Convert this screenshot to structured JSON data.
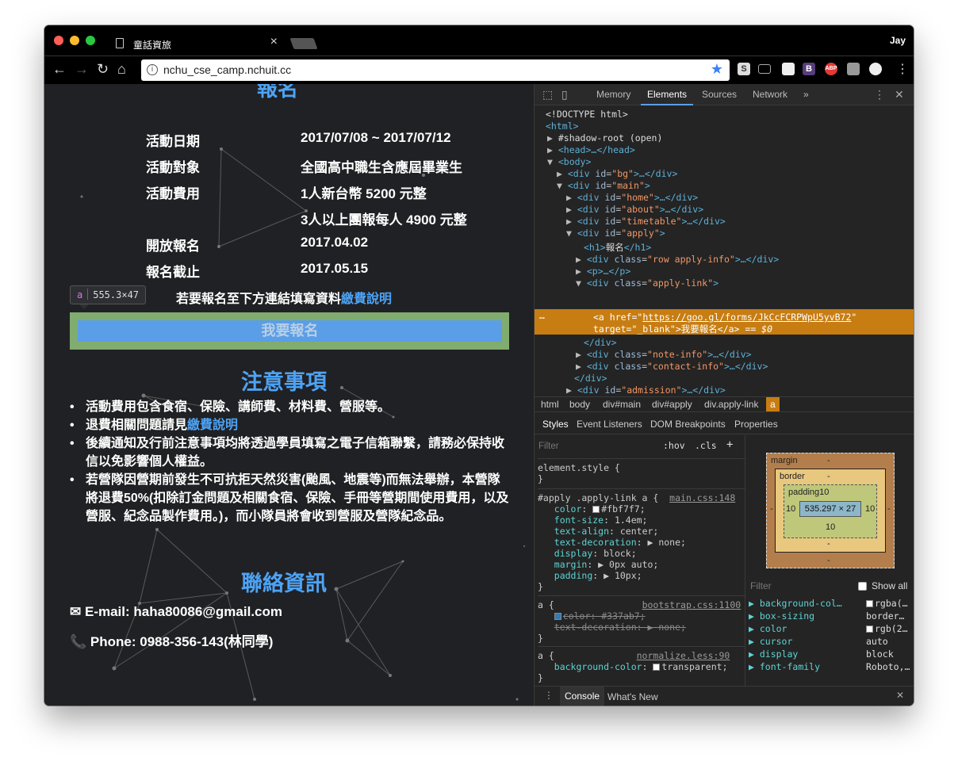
{
  "browser": {
    "tab_title": "童話資旅",
    "tab_close": "×",
    "profile": "Jay",
    "url": "nchu_cse_camp.nchuit.cc",
    "nav": {
      "back": "←",
      "forward": "→",
      "reload": "↻",
      "home": "⌂"
    },
    "star": "★",
    "extensions": [
      "S",
      "B",
      "ABP"
    ]
  },
  "page": {
    "heading_cut": "報名",
    "info_rows": [
      {
        "label": "活動日期",
        "value": "2017/07/08 ~ 2017/07/12"
      },
      {
        "label": "活動對象",
        "value": "全國高中職生含應屆畢業生"
      },
      {
        "label": "活動費用",
        "value": "1人新台幣 5200 元整"
      },
      {
        "label": "",
        "value": "3人以上團報每人 4900 元整"
      },
      {
        "label": "開放報名",
        "value": "2017.04.02"
      },
      {
        "label": "報名截止",
        "value": "2017.05.15"
      }
    ],
    "tooltip": {
      "tag": "a",
      "size": "555.3×47"
    },
    "apply_note": "若要報名至下方連結填寫資料",
    "fee_link": "繳費說明",
    "apply_button": "我要報名",
    "notice_title": "注意事項",
    "notices": [
      {
        "text": "活動費用包含食宿、保險、講師費、材料費、營服等。",
        "link": ""
      },
      {
        "text": "退費相關問題請見",
        "link": "繳費說明"
      },
      {
        "text": "後續通知及行前注意事項均將透過學員填寫之電子信箱聯繫，請務必保持收信以免影響個人權益。",
        "link": ""
      },
      {
        "text": "若營隊因營期前發生不可抗拒天然災害(颱風、地震等)而無法舉辦，本營隊將退費50%(扣除訂金問題及相關食宿、保險、手冊等營期間使用費用，以及營服、紀念品製作費用。)，而小隊員將會收到營服及營隊紀念品。",
        "link": ""
      }
    ],
    "contact_title": "聯絡資訊",
    "email": "E-mail: haha80086@gmail.com",
    "phone": "Phone: 0988-356-143(林同學)"
  },
  "devtools": {
    "tabs": [
      "Memory",
      "Elements",
      "Sources",
      "Network",
      "»"
    ],
    "dom": {
      "doctype": "<!DOCTYPE html>",
      "html": "<html>",
      "shadow": "#shadow-root (open)",
      "head": "<head>…</head>",
      "body": "<body>",
      "h1_text": "報名",
      "link_href": "https://goo.gl/forms/JkCcFCRPWpU5yvB72",
      "link_text": "我要報名",
      "eq": "== $0"
    },
    "breadcrumbs": [
      "html",
      "body",
      "div#main",
      "div#apply",
      "div.apply-link",
      "a"
    ],
    "subtabs": [
      "Styles",
      "Event Listeners",
      "DOM Breakpoints",
      "Properties"
    ],
    "filter_placeholder": "Filter",
    "hov": ":hov",
    "cls": ".cls",
    "box": {
      "margin": "margin",
      "border": "border",
      "padding": "padding10",
      "content": "535.297 × 27",
      "dash": "-",
      "ten": "10"
    },
    "filter2": "Filter",
    "show_all": "Show all",
    "computed": [
      {
        "prop": "background-col…",
        "val": "rgba(…"
      },
      {
        "prop": "box-sizing",
        "val": "border…"
      },
      {
        "prop": "color",
        "val": "rgb(2…"
      },
      {
        "prop": "cursor",
        "val": "auto"
      },
      {
        "prop": "display",
        "val": "block"
      },
      {
        "prop": "font-family",
        "val": "Roboto,…"
      }
    ],
    "console_tabs": [
      "Console",
      "What's New"
    ]
  }
}
